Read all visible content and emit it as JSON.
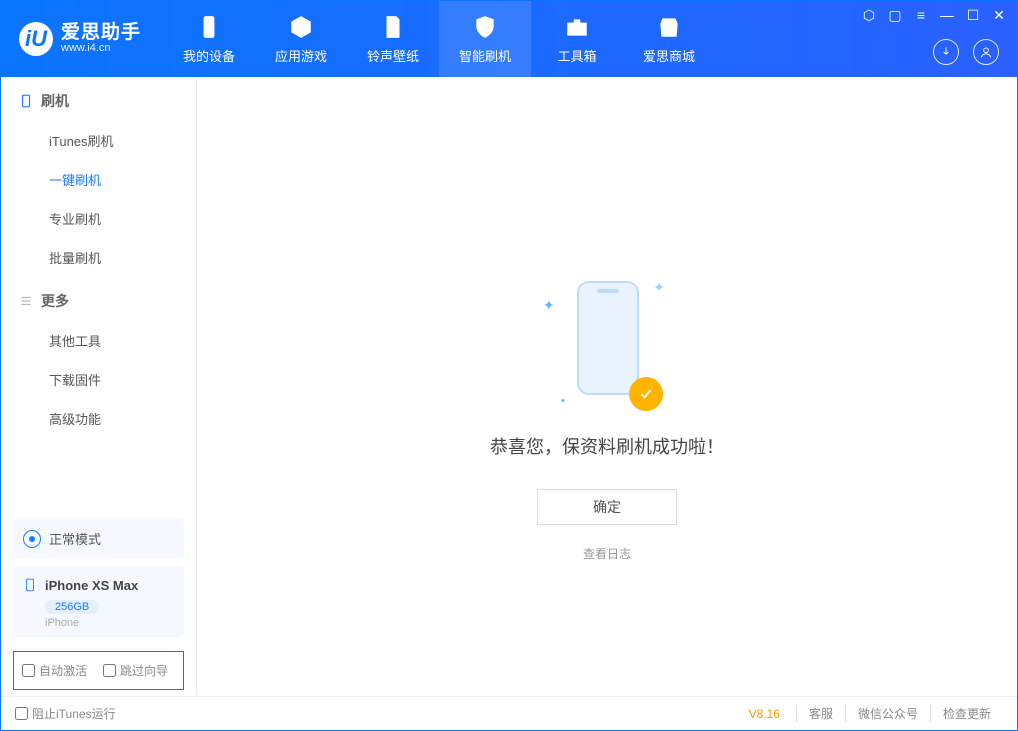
{
  "app": {
    "name": "爱思助手",
    "site": "www.i4.cn",
    "logo_letter": "iU"
  },
  "nav": {
    "items": [
      {
        "label": "我的设备"
      },
      {
        "label": "应用游戏"
      },
      {
        "label": "铃声壁纸"
      },
      {
        "label": "智能刷机"
      },
      {
        "label": "工具箱"
      },
      {
        "label": "爱思商城"
      }
    ],
    "active_index": 3
  },
  "sidebar": {
    "group1": {
      "title": "刷机",
      "items": [
        {
          "label": "iTunes刷机"
        },
        {
          "label": "一键刷机"
        },
        {
          "label": "专业刷机"
        },
        {
          "label": "批量刷机"
        }
      ],
      "active_index": 1
    },
    "group2": {
      "title": "更多",
      "items": [
        {
          "label": "其他工具"
        },
        {
          "label": "下载固件"
        },
        {
          "label": "高级功能"
        }
      ]
    },
    "mode_card": {
      "label": "正常模式"
    },
    "device_card": {
      "name": "iPhone XS Max",
      "storage": "256GB",
      "type": "iPhone"
    },
    "checkboxes": {
      "auto_activate": "自动激活",
      "skip_guide": "跳过向导"
    }
  },
  "main": {
    "success_text": "恭喜您，保资料刷机成功啦！",
    "ok_label": "确定",
    "view_log": "查看日志"
  },
  "footer": {
    "block_itunes": "阻止iTunes运行",
    "version": "V8.16",
    "links": [
      "客服",
      "微信公众号",
      "检查更新"
    ]
  }
}
